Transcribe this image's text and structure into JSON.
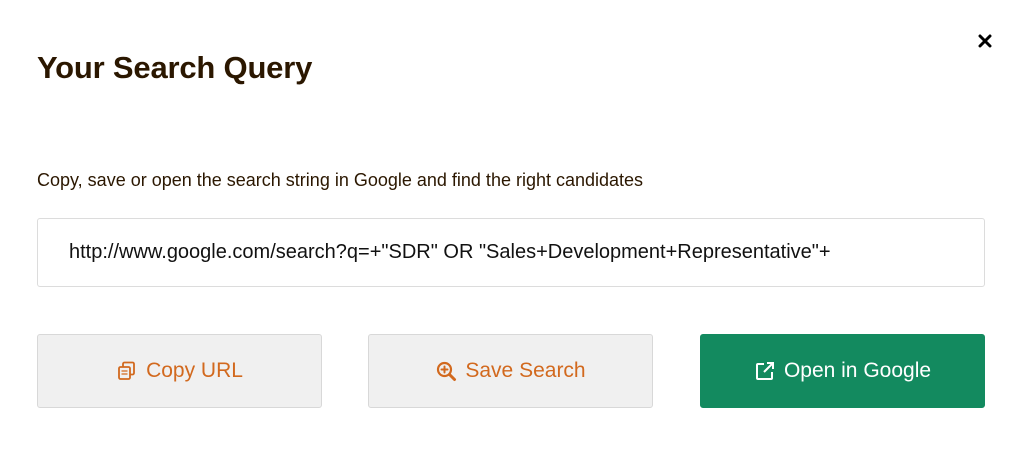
{
  "modal": {
    "title": "Your Search Query",
    "subtitle": "Copy, save or open the search string in Google and find the right candidates",
    "search_url": "http://www.google.com/search?q=+\"SDR\" OR \"Sales+Development+Representative\"+",
    "close_icon": "close-icon"
  },
  "buttons": {
    "copy_label": "Copy URL",
    "save_label": "Save Search",
    "open_label": "Open in Google",
    "copy_icon": "copy-icon",
    "save_icon": "search-plus-icon",
    "open_icon": "external-link-icon"
  },
  "colors": {
    "title": "#2b1700",
    "accent_orange": "#d2691e",
    "primary_green": "#138a5f",
    "light_button_bg": "#f0f0f0"
  }
}
